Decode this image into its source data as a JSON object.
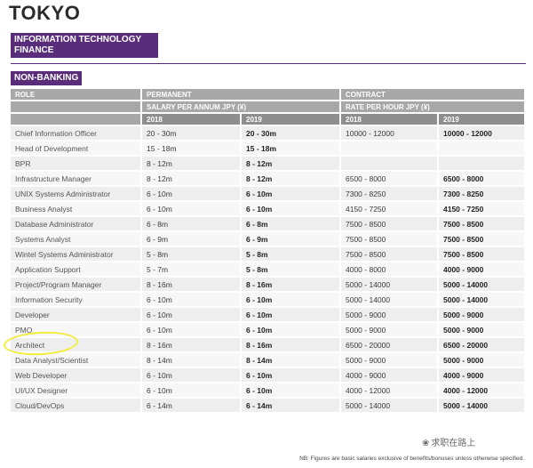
{
  "city": "TOKYO",
  "sector": "INFORMATION TECHNOLOGY FINANCE",
  "subsector": "NON-BANKING",
  "headers": {
    "role": "ROLE",
    "permanent": "PERMANENT",
    "contract": "CONTRACT",
    "permanent_sub": "SALARY PER ANNUM JPY (¥)",
    "contract_sub": "RATE PER HOUR JPY (¥)",
    "year1": "2018",
    "year2": "2019"
  },
  "rows": [
    {
      "role": "Chief Information Officer",
      "p2018": "20 - 30m",
      "p2019": "20 - 30m",
      "c2018": "10000 - 12000",
      "c2019": "10000 - 12000"
    },
    {
      "role": "Head of Development",
      "p2018": "15 - 18m",
      "p2019": "15 - 18m",
      "c2018": "",
      "c2019": ""
    },
    {
      "role": "BPR",
      "p2018": "8 - 12m",
      "p2019": "8 - 12m",
      "c2018": "",
      "c2019": ""
    },
    {
      "role": "Infrastructure Manager",
      "p2018": "8 - 12m",
      "p2019": "8 - 12m",
      "c2018": "6500 - 8000",
      "c2019": "6500 - 8000"
    },
    {
      "role": "UNIX Systems Administrator",
      "p2018": "6 - 10m",
      "p2019": "6 - 10m",
      "c2018": "7300 - 8250",
      "c2019": "7300 - 8250"
    },
    {
      "role": "Business Analyst",
      "p2018": "6 - 10m",
      "p2019": "6 - 10m",
      "c2018": "4150 - 7250",
      "c2019": "4150 - 7250"
    },
    {
      "role": "Database Administrator",
      "p2018": "6 - 8m",
      "p2019": "6 - 8m",
      "c2018": "7500 - 8500",
      "c2019": "7500 - 8500"
    },
    {
      "role": "Systems Analyst",
      "p2018": "6 - 9m",
      "p2019": "6 - 9m",
      "c2018": "7500 - 8500",
      "c2019": "7500 - 8500"
    },
    {
      "role": "Wintel Systems Administrator",
      "p2018": "5 - 8m",
      "p2019": "5 - 8m",
      "c2018": "7500 - 8500",
      "c2019": "7500 - 8500"
    },
    {
      "role": "Application Support",
      "p2018": "5 - 7m",
      "p2019": "5 - 8m",
      "c2018": "4000 - 8000",
      "c2019": "4000 - 9000"
    },
    {
      "role": "Project/Program Manager",
      "p2018": "8 - 16m",
      "p2019": "8 - 16m",
      "c2018": "5000 - 14000",
      "c2019": "5000 - 14000"
    },
    {
      "role": "Information Security",
      "p2018": "6 - 10m",
      "p2019": "6 - 10m",
      "c2018": "5000 - 14000",
      "c2019": "5000 - 14000"
    },
    {
      "role": "Developer",
      "p2018": "6 - 10m",
      "p2019": "6 - 10m",
      "c2018": "5000 - 9000",
      "c2019": "5000 - 9000"
    },
    {
      "role": "PMO",
      "p2018": "6 - 10m",
      "p2019": "6 - 10m",
      "c2018": "5000 - 9000",
      "c2019": "5000 - 9000"
    },
    {
      "role": "Architect",
      "p2018": "8 - 16m",
      "p2019": "8 - 16m",
      "c2018": "6500 - 20000",
      "c2019": "6500 - 20000"
    },
    {
      "role": "Data Analyst/Scientist",
      "p2018": "8 - 14m",
      "p2019": "8 - 14m",
      "c2018": "5000 - 9000",
      "c2019": "5000 - 9000"
    },
    {
      "role": "Web Developer",
      "p2018": "6 - 10m",
      "p2019": "6 - 10m",
      "c2018": "4000 - 9000",
      "c2019": "4000 - 9000"
    },
    {
      "role": "UI/UX Designer",
      "p2018": "6 - 10m",
      "p2019": "6 - 10m",
      "c2018": "4000 - 12000",
      "c2019": "4000 - 12000"
    },
    {
      "role": "Cloud/DevOps",
      "p2018": "6 - 14m",
      "p2019": "6 - 14m",
      "c2018": "5000 - 14000",
      "c2019": "5000 - 14000"
    }
  ],
  "note": "NB: Figures are basic salaries exclusive of benefits/bonuses unless otherwise specified.",
  "watermark": "求职在路上",
  "colors": {
    "accent": "#5a2d7a",
    "header": "#a8a8a8",
    "highlight": "#f2ec3a"
  }
}
